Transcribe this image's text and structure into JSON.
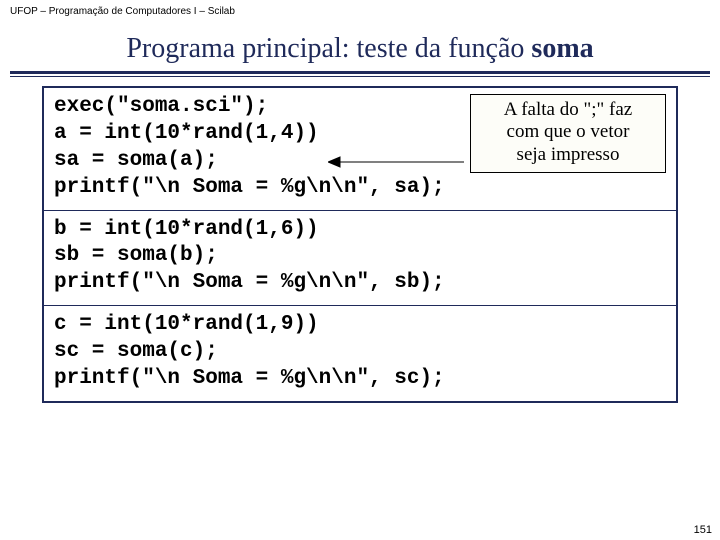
{
  "header": "UFOP – Programação de Computadores I – Scilab",
  "title_plain": "Programa principal: teste da função ",
  "title_bold": "soma",
  "callout": {
    "line1": "A falta do \";\" faz",
    "line2": "com que o vetor",
    "line3": "seja impresso"
  },
  "code": {
    "b1l1": "exec(\"soma.sci\");",
    "b1l2": "",
    "b1l3": "a = int(10*rand(1,4))",
    "b1l4": "sa = soma(a);",
    "b1l5": "printf(\"\\n Soma = %g\\n\\n\", sa);",
    "b2l1": "b = int(10*rand(1,6))",
    "b2l2": "sb = soma(b);",
    "b2l3": "printf(\"\\n Soma = %g\\n\\n\", sb);",
    "b3l1": "c = int(10*rand(1,9))",
    "b3l2": "sc = soma(c);",
    "b3l3": "printf(\"\\n Soma = %g\\n\\n\", sc);"
  },
  "pagenum": "151"
}
